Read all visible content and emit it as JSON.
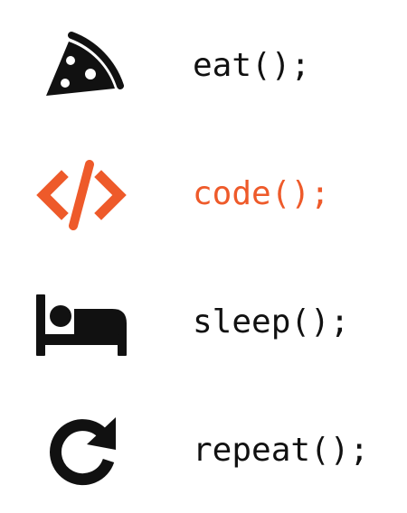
{
  "colors": {
    "default": "#111111",
    "accent": "#ee5a2a"
  },
  "items": [
    {
      "icon": "pizza-slice-icon",
      "label": "eat();",
      "highlighted": false
    },
    {
      "icon": "code-brackets-icon",
      "label": "code();",
      "highlighted": true
    },
    {
      "icon": "bed-icon",
      "label": "sleep();",
      "highlighted": false
    },
    {
      "icon": "redo-arrow-icon",
      "label": "repeat();",
      "highlighted": false
    }
  ]
}
